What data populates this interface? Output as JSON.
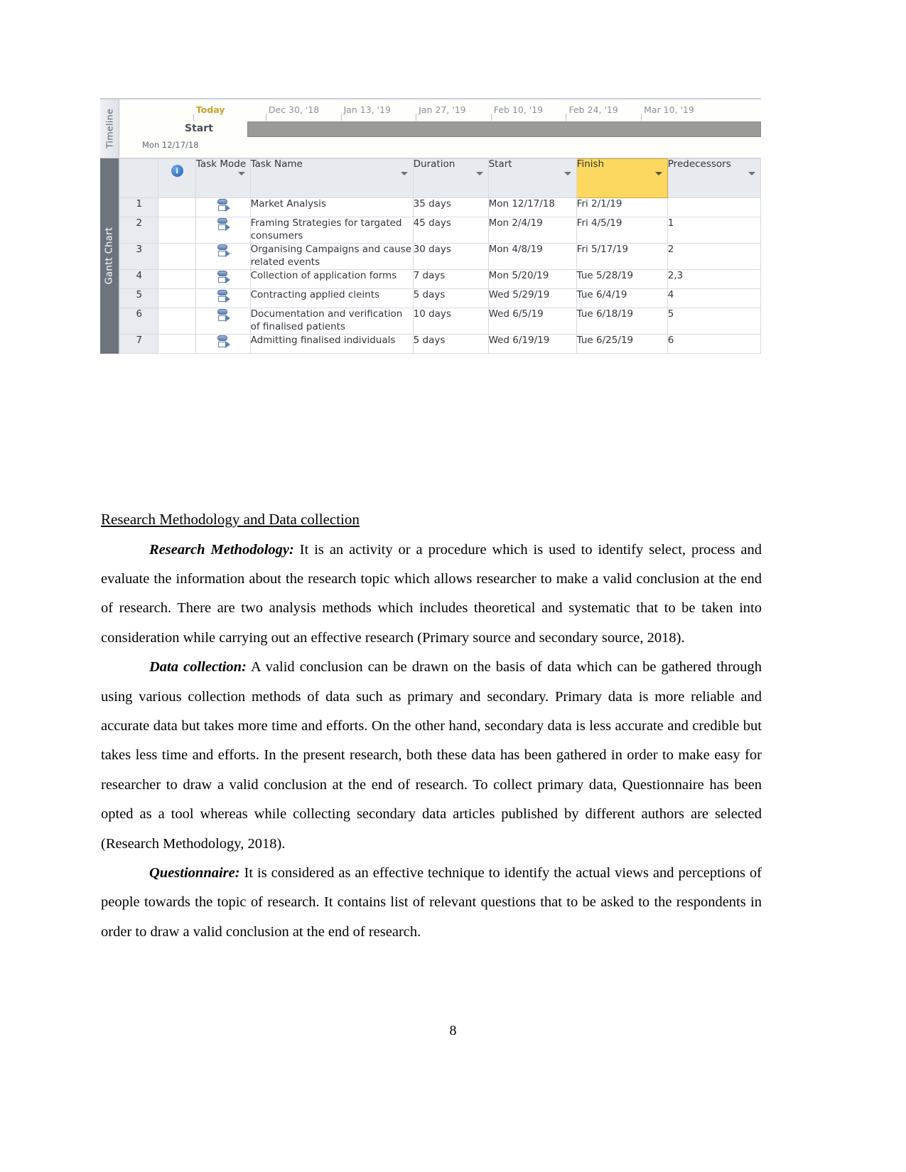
{
  "gantt": {
    "timeline_tab_label": "Timeline",
    "gantt_tab_label": "Gantt Chart",
    "timeline": {
      "start_label": "Start",
      "start_date": "Mon 12/17/18",
      "ticks": [
        {
          "label": "Today",
          "highlight": true,
          "left_pct": 11.5
        },
        {
          "label": "Dec 30, '18",
          "highlight": false,
          "left_pct": 22.8
        },
        {
          "label": "Jan 13, '19",
          "highlight": false,
          "left_pct": 34.5
        },
        {
          "label": "Jan 27, '19",
          "highlight": false,
          "left_pct": 46.2
        },
        {
          "label": "Feb 10, '19",
          "highlight": false,
          "left_pct": 57.9
        },
        {
          "label": "Feb 24, '19",
          "highlight": false,
          "left_pct": 69.6
        },
        {
          "label": "Mar 10, '19",
          "highlight": false,
          "left_pct": 81.3
        }
      ]
    },
    "columns": {
      "id": "",
      "info": "i",
      "task_mode": "Task Mode",
      "task_name": "Task Name",
      "duration": "Duration",
      "start": "Start",
      "finish": "Finish",
      "predecessors": "Predecessors"
    },
    "highlight_color": "#fcd860",
    "rows": [
      {
        "id": "1",
        "name": "Market Analysis",
        "duration": "35 days",
        "start": "Mon 12/17/18",
        "finish": "Fri 2/1/19",
        "predecessors": ""
      },
      {
        "id": "2",
        "name": "Framing Strategies for targated consumers",
        "duration": "45 days",
        "start": "Mon 2/4/19",
        "finish": "Fri 4/5/19",
        "predecessors": "1"
      },
      {
        "id": "3",
        "name": "Organising Campaigns and cause related events",
        "duration": "30 days",
        "start": "Mon 4/8/19",
        "finish": "Fri 5/17/19",
        "predecessors": "2"
      },
      {
        "id": "4",
        "name": "Collection of application forms",
        "duration": "7 days",
        "start": "Mon 5/20/19",
        "finish": "Tue 5/28/19",
        "predecessors": "2,3"
      },
      {
        "id": "5",
        "name": "Contracting applied cleints",
        "duration": "5 days",
        "start": "Wed 5/29/19",
        "finish": "Tue 6/4/19",
        "predecessors": "4"
      },
      {
        "id": "6",
        "name": "Documentation and verification of finalised patients",
        "duration": "10 days",
        "start": "Wed 6/5/19",
        "finish": "Tue 6/18/19",
        "predecessors": "5"
      },
      {
        "id": "7",
        "name": "Admitting finalised individuals",
        "duration": "5 days",
        "start": "Wed 6/19/19",
        "finish": "Tue 6/25/19",
        "predecessors": "6"
      }
    ]
  },
  "document": {
    "heading": "Research Methodology and Data collection",
    "paragraphs": [
      {
        "lead": "Research Methodology:",
        "text": " It is an activity or a procedure which is used to identify select, process and evaluate the information about the research topic which allows researcher to make a valid conclusion at the end of research. There are two analysis methods which includes theoretical and systematic that to be taken into consideration while carrying out an effective research (Primary source and secondary source, 2018)."
      },
      {
        "lead": "Data collection:",
        "text": " A valid conclusion can be drawn on the basis of data which can be gathered through using various collection methods of data such as primary and secondary. Primary data is more reliable and accurate data but takes more time and efforts. On the other hand, secondary data is less accurate and credible but takes less time and efforts. In the present research, both these data has been gathered in order to make easy for researcher to draw a valid conclusion at the end of research. To collect primary data, Questionnaire has been opted as a tool whereas while collecting secondary data articles published by different authors are selected (Research Methodology, 2018)."
      },
      {
        "lead": "Questionnaire:",
        "text": " It is considered as an effective technique to identify the actual views and perceptions of people towards the topic of research. It contains list of relevant questions that to be asked to the respondents in order to draw a valid conclusion at the end of research."
      }
    ],
    "page_number": "8"
  }
}
